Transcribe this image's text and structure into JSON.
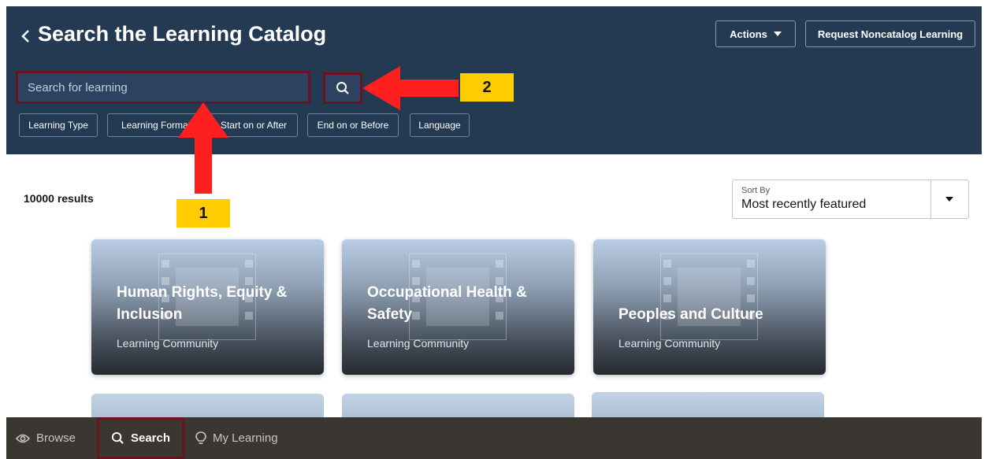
{
  "header": {
    "title": "Search the Learning Catalog",
    "actions_label": "Actions",
    "request_label": "Request Noncatalog Learning",
    "back_icon": "chevron-left-icon"
  },
  "search": {
    "placeholder": "Search for learning",
    "button_icon": "search-icon"
  },
  "filters": [
    {
      "label": "Learning Type"
    },
    {
      "label": "Learning Format"
    },
    {
      "label": "Start on or After"
    },
    {
      "label": "End on or Before"
    },
    {
      "label": "Language"
    }
  ],
  "results": {
    "count_text": "10000 results"
  },
  "sort": {
    "label": "Sort By",
    "value": "Most recently featured"
  },
  "cards": [
    {
      "title_line1": "Human Rights, Equity &",
      "title_line2": "Inclusion",
      "subtitle": "Learning Community"
    },
    {
      "title_line1": "Occupational Health &",
      "title_line2": "Safety",
      "subtitle": "Learning Community"
    },
    {
      "title_line1": "Peoples and Culture",
      "title_line2": "",
      "subtitle": "Learning Community"
    }
  ],
  "bottom_nav": {
    "browse": "Browse",
    "search": "Search",
    "my_learning": "My Learning"
  },
  "annotations": {
    "step1": "1",
    "step2": "2"
  },
  "colors": {
    "header_bg": "#243a53",
    "highlight_border": "#6a1420",
    "annotation_yellow": "#ffcc00",
    "arrow_red": "#ff1f1f",
    "nav_bg": "#3a3631"
  }
}
